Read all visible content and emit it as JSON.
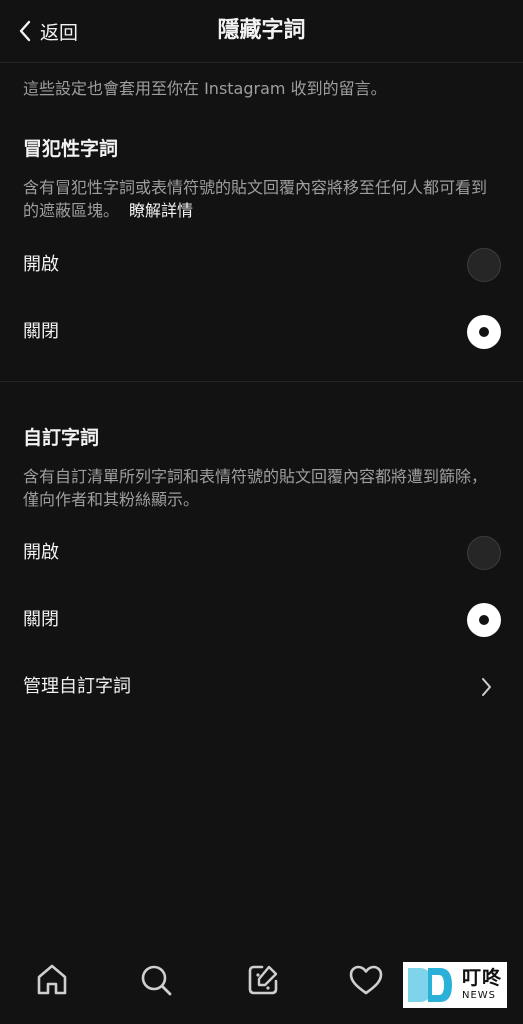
{
  "header": {
    "back_label": "返回",
    "title": "隱藏字詞"
  },
  "intro": "這些設定也會套用至你在 Instagram 收到的留言。",
  "offensive": {
    "title": "冒犯性字詞",
    "description": "含有冒犯性字詞或表情符號的貼文回覆內容將移至任何人都可看到的遮蔽區塊。",
    "learn_more": "瞭解詳情",
    "options": [
      {
        "label": "開啟",
        "selected": false
      },
      {
        "label": "關閉",
        "selected": true
      }
    ]
  },
  "custom": {
    "title": "自訂字詞",
    "description": "含有自訂清單所列字詞和表情符號的貼文回覆內容都將遭到篩除，僅向作者和其粉絲顯示。",
    "options": [
      {
        "label": "開啟",
        "selected": false
      },
      {
        "label": "關閉",
        "selected": true
      }
    ],
    "manage_label": "管理自訂字詞"
  },
  "tabbar": {
    "tabs": [
      "home-icon",
      "search-icon",
      "compose-icon",
      "heart-icon"
    ]
  },
  "watermark": {
    "cn": "叮咚",
    "en": "NEWS"
  },
  "colors": {
    "background": "#121212",
    "text": "#f2f2f2",
    "secondary_text": "#9e9e9e",
    "divider": "#262626"
  }
}
